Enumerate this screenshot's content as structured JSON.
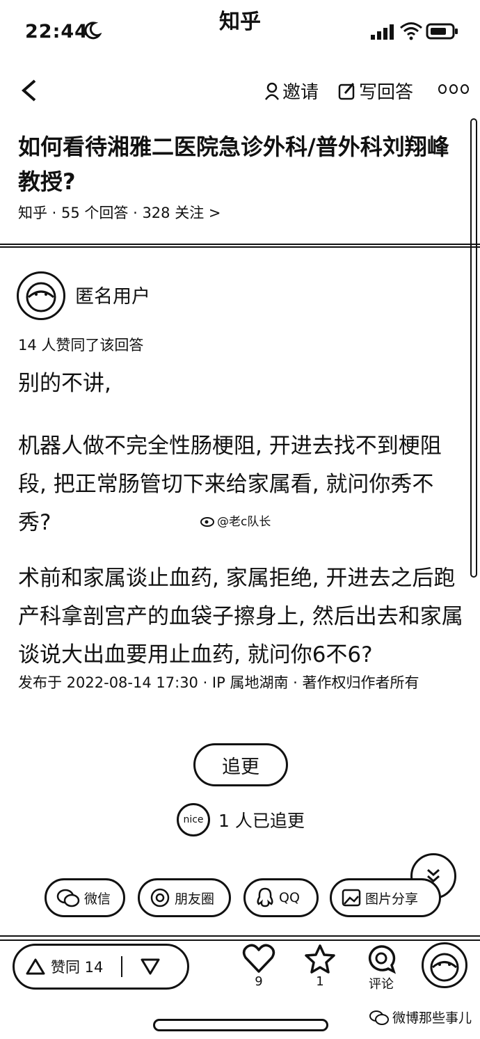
{
  "status_bar": {
    "time": "22:44",
    "app_name": "知乎"
  },
  "nav": {
    "invite_label": "邀请",
    "write_answer_label": "写回答"
  },
  "question": {
    "title": "如何看待湘雅二医院急诊外科/普外科刘翔峰教授?",
    "meta": "知乎 · 55 个回答 · 328 关注 >"
  },
  "answer": {
    "author": "匿名用户",
    "vote_summary": "14 人赞同了该回答",
    "paragraphs": [
      "别的不讲,",
      "机器人做不完全性肠梗阻, 开进去找不到梗阻段, 把正常肠管切下来给家属看, 就问你秀不秀?",
      "术前和家属谈止血药, 家属拒绝, 开进去之后跑产科拿剖宫产的血袋子擦身上, 然后出去和家属谈说大出血要用止血药, 就问你6不6?"
    ],
    "watermark": "@老c队长",
    "publish_info": "发布于 2022-08-14 17:30 · IP 属地湖南 · 著作权归作者所有"
  },
  "follow_up": {
    "button_label": "追更",
    "count_text": "1 人已追更",
    "follower_badge": "nice"
  },
  "share": {
    "wechat": "微信",
    "moments": "朋友圈",
    "qq": "QQ",
    "image": "图片分享"
  },
  "actions": {
    "vote_label": "赞同 14",
    "like_count": "9",
    "favorite_count": "1",
    "comment_label": "评论"
  },
  "footer_watermark": "微博那些事儿"
}
